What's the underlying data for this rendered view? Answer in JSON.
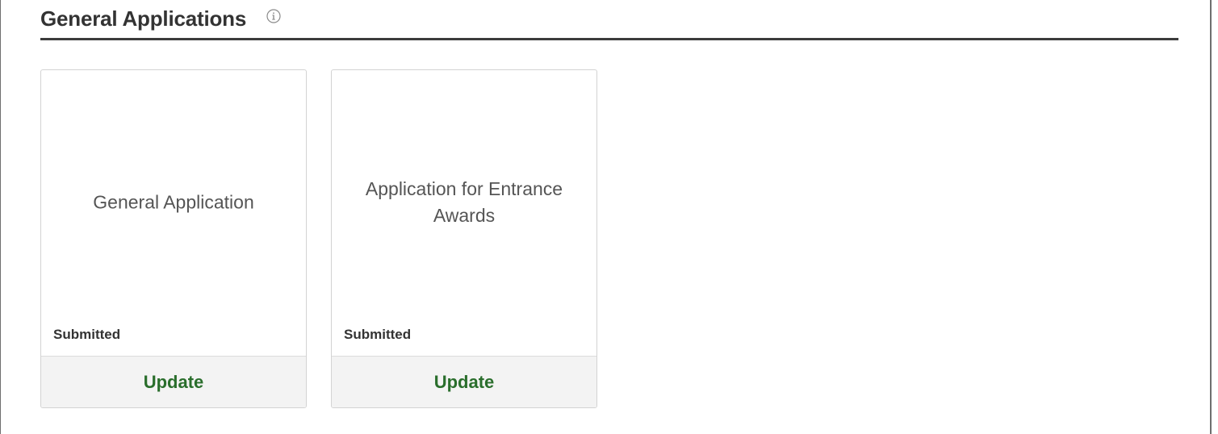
{
  "section": {
    "title": "General Applications",
    "info_icon": "info-circle-icon"
  },
  "tiles": [
    {
      "title": "General Application",
      "status": "Submitted",
      "action_label": "Update"
    },
    {
      "title": "Application for Entrance Awards",
      "status": "Submitted",
      "action_label": "Update"
    }
  ],
  "colors": {
    "header_rule": "#3c3c3c",
    "action_green": "#2a6e2c",
    "footer_bg": "#f3f3f3",
    "tile_border": "#d3d3d3"
  }
}
